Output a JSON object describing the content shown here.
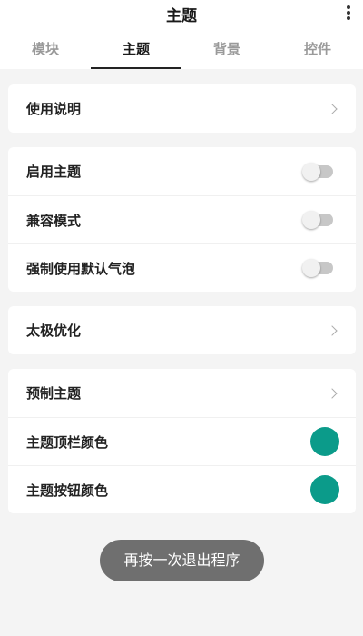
{
  "appbar": {
    "title": "主题",
    "more_icon": "more-vertical-icon"
  },
  "tabs": [
    {
      "label": "模块",
      "active": false
    },
    {
      "label": "主题",
      "active": true
    },
    {
      "label": "背景",
      "active": false
    },
    {
      "label": "控件",
      "active": false
    }
  ],
  "sections": {
    "instructions": {
      "label": "使用说明"
    },
    "toggles": [
      {
        "label": "启用主题",
        "on": false
      },
      {
        "label": "兼容模式",
        "on": false
      },
      {
        "label": "强制使用默认气泡",
        "on": false
      }
    ],
    "taiji": {
      "label": "太极优化"
    },
    "theme": {
      "preset_label": "预制主题",
      "topbar_color_label": "主题顶栏颜色",
      "button_color_label": "主题按钮颜色",
      "topbar_color": "#0b9b8a",
      "button_color": "#0b9b8a"
    }
  },
  "toast": {
    "text": "再按一次退出程序"
  }
}
